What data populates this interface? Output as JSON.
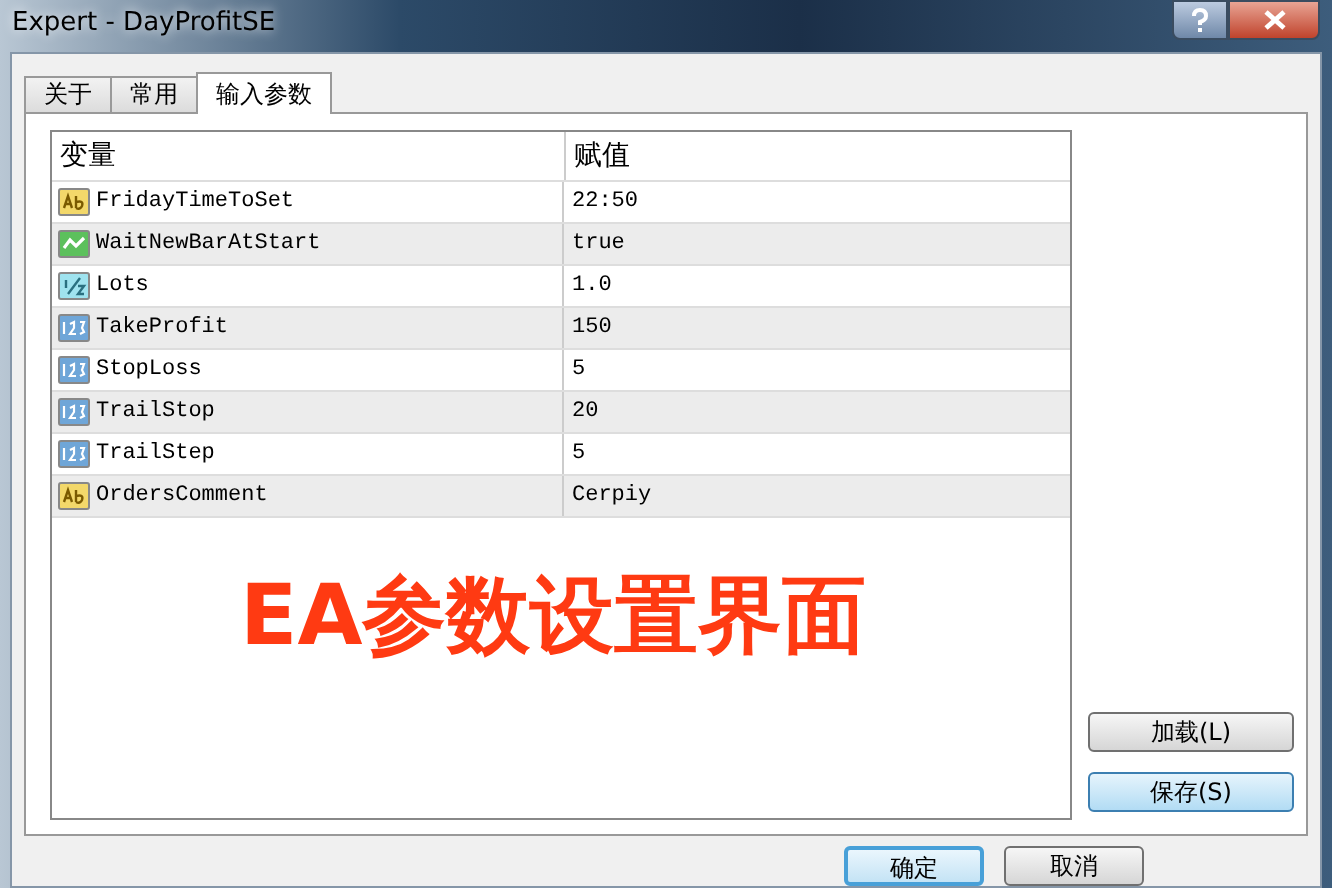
{
  "window": {
    "title": "Expert - DayProfitSE"
  },
  "tabs": [
    {
      "label": "关于",
      "selected": false
    },
    {
      "label": "常用",
      "selected": false
    },
    {
      "label": "输入参数",
      "selected": true
    }
  ],
  "table": {
    "columns": [
      "变量",
      "赋值"
    ],
    "rows": [
      {
        "kind": "string",
        "name": "FridayTimeToSet",
        "value": "22:50"
      },
      {
        "kind": "bool",
        "name": "WaitNewBarAtStart",
        "value": "true"
      },
      {
        "kind": "double",
        "name": "Lots",
        "value": "1.0"
      },
      {
        "kind": "int",
        "name": "TakeProfit",
        "value": "150"
      },
      {
        "kind": "int",
        "name": "StopLoss",
        "value": "5"
      },
      {
        "kind": "int",
        "name": "TrailStop",
        "value": "20"
      },
      {
        "kind": "int",
        "name": "TrailStep",
        "value": "5"
      },
      {
        "kind": "string",
        "name": "OrdersComment",
        "value": "Cerpiy"
      }
    ]
  },
  "caption": "EA参数设置界面",
  "side_buttons": [
    {
      "label": "加载(L)",
      "highlighted": false
    },
    {
      "label": "保存(S)",
      "highlighted": true
    }
  ],
  "bottom_buttons": [
    {
      "label": "确定",
      "default": true
    },
    {
      "label": "取消",
      "default": false
    }
  ]
}
